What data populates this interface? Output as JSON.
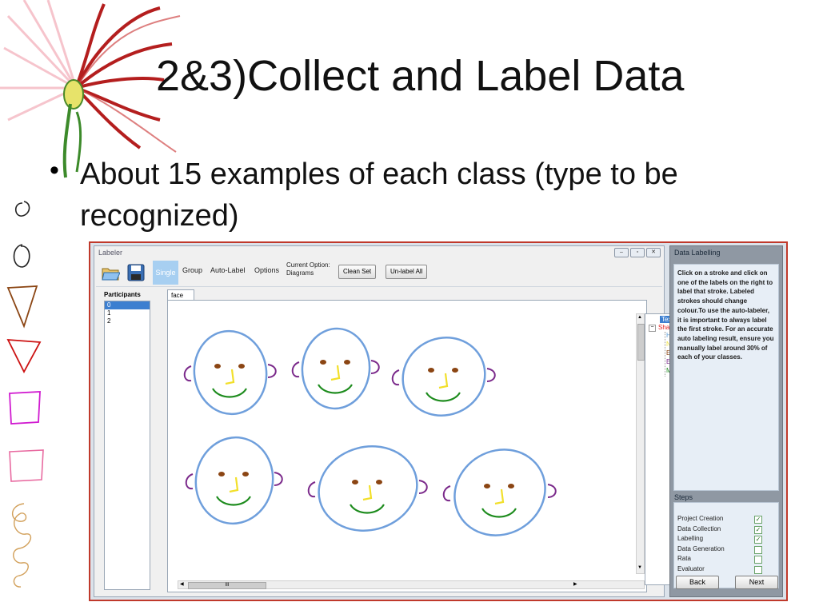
{
  "slide": {
    "title": "2&3)Collect and Label Data",
    "bullet": "About 15 examples of each class (type to be recognized)"
  },
  "labeler": {
    "window_title": "Labeler",
    "buttons": {
      "minimize": "–",
      "restore": "▫",
      "close": "✕"
    },
    "toolbar": {
      "single": "Single",
      "group": "Group",
      "auto_label": "Auto-Label",
      "options": "Options",
      "current_option_label": "Current Option:",
      "current_option_value": "Diagrams",
      "clean_set": "Clean Set",
      "unlabel_all": "Un-label All"
    },
    "participants_header": "Participants",
    "participants": [
      "0",
      "1",
      "2"
    ],
    "tab": "face",
    "hscroll_thumb": "III",
    "tree": {
      "root": "Text",
      "shape": "Shape",
      "children": [
        {
          "label": "Head",
          "color": "#5b9bd5"
        },
        {
          "label": "Nose",
          "color": "#f2e33b"
        },
        {
          "label": "Eyes",
          "color": "#8b4513"
        },
        {
          "label": "Ears",
          "color": "#7b2a8b"
        },
        {
          "label": "Mouth",
          "color": "#1e8c1e"
        }
      ]
    }
  },
  "panel": {
    "data_labelling_header": "Data Labelling",
    "instructions": "Click on a stroke and click on one of the labels on the right to label that stroke. Labeled strokes should change colour.To use the auto-labeler, it is important to always label the first stroke. For an accurate auto labeling result, ensure you manually label around 30% of each of your classes.",
    "steps_header": "Steps",
    "steps": [
      {
        "label": "Project Creation",
        "checked": true
      },
      {
        "label": "Data Collection",
        "checked": true
      },
      {
        "label": "Labelling",
        "checked": true
      },
      {
        "label": "Data Generation",
        "checked": false
      },
      {
        "label": "Rata",
        "checked": false
      },
      {
        "label": "Evaluator",
        "checked": false
      }
    ],
    "back": "Back",
    "next": "Next"
  },
  "colors": {
    "head": "#6f9fdc",
    "eyes": "#8b4513",
    "nose": "#f2df2a",
    "ears": "#7b2a8b",
    "mouth": "#1e8c1e",
    "frame": "#c0392b"
  }
}
